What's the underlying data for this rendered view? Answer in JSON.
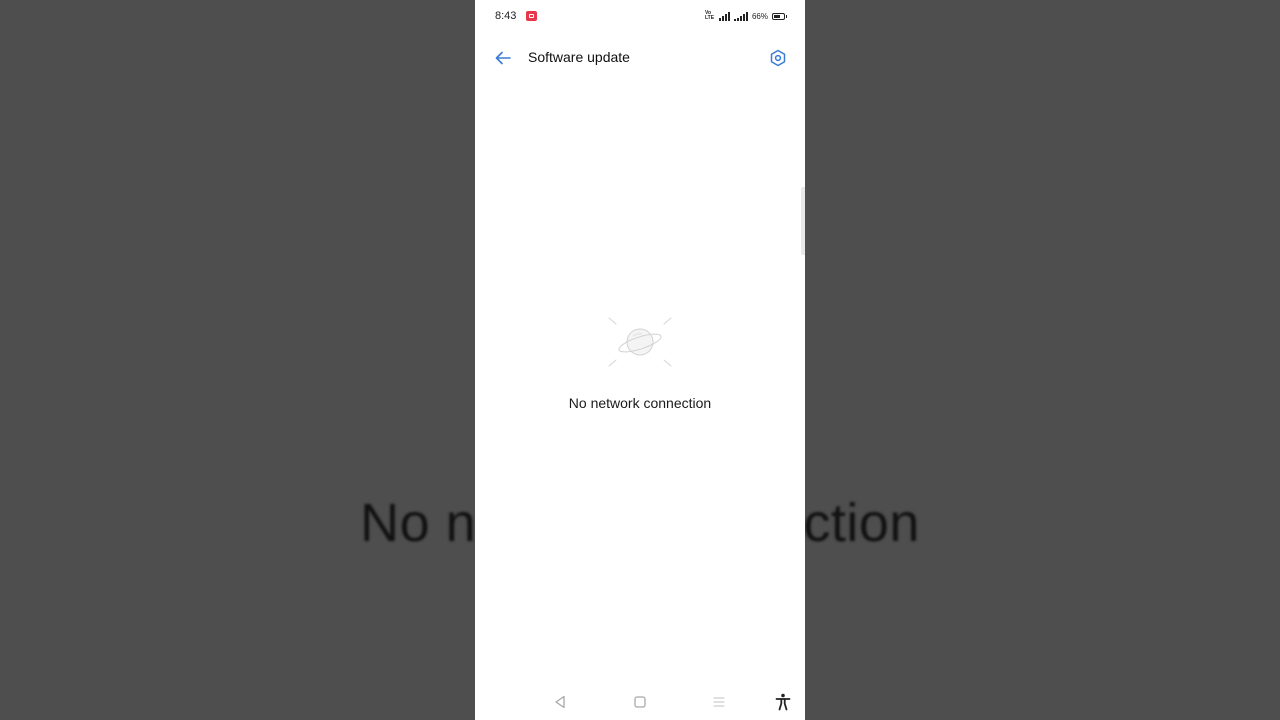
{
  "background": {
    "blurred_text": "No network connection"
  },
  "status_bar": {
    "time": "8:43",
    "volte_label": "Vo LTE",
    "battery_percent": "66%",
    "battery_level": 0.66
  },
  "app_bar": {
    "title": "Software update"
  },
  "empty_state": {
    "message": "No network connection",
    "icon": "planet-icon"
  },
  "navigation": {
    "buttons": [
      "back-triangle-icon",
      "home-square-icon",
      "recents-menu-icon",
      "accessibility-icon"
    ]
  },
  "colors": {
    "accent": "#3a7bd5",
    "record_badge": "#e5384a",
    "backdrop": "#4e4e4e"
  }
}
